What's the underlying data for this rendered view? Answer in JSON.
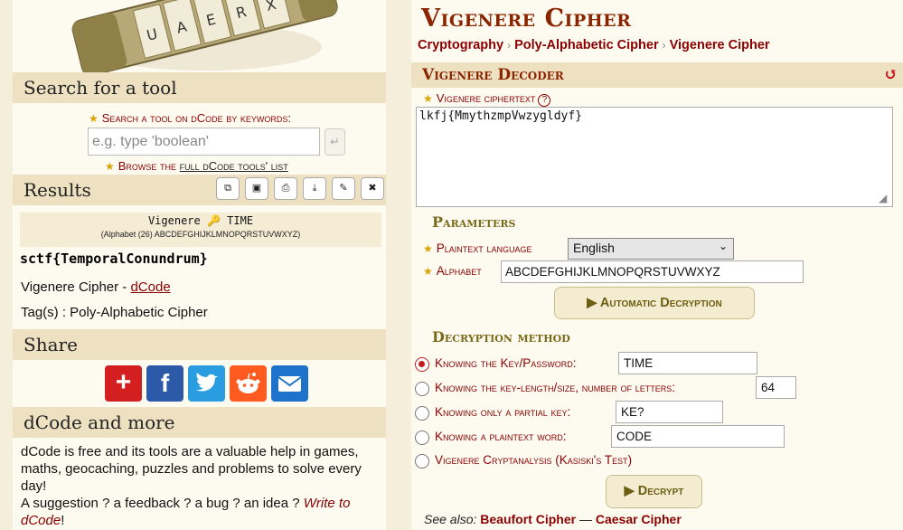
{
  "sidebar": {
    "search_heading": "Search for a tool",
    "search_label": "Search a tool on dCode by keywords:",
    "search_placeholder": "e.g. type 'boolean'",
    "search_go_icon": "↵",
    "browse_prefix": "Browse the ",
    "browse_link": "full dCode tools' list",
    "results_heading": "Results",
    "result_title": "Vigenere 🔑 TIME",
    "result_alphabet": "(Alphabet (26) ABCDEFGHIJKLMNOPQRSTUVWXYZ)",
    "result_plaintext": "sctf{TemporalConundrum}",
    "credit_prefix": "Vigenere Cipher - ",
    "credit_link": "dCode",
    "tags": "Tag(s) : Poly-Alphabetic Cipher",
    "share_heading": "Share",
    "more_heading": "dCode and more",
    "more_text_1": "dCode is free and its tools are a valuable help in games, maths, geocaching, puzzles and problems to solve every day!",
    "more_text_2": "A suggestion ? a feedback ? a bug ? an idea ? ",
    "more_text_link": "Write to dCode",
    "more_text_end": "!"
  },
  "main": {
    "title": "Vigenere Cipher",
    "breadcrumb": [
      "Cryptography",
      "Poly-Alphabetic Cipher",
      "Vigenere Cipher"
    ],
    "decoder_heading": "Vigenere Decoder",
    "ciphertext_label": "Vigenere ciphertext",
    "ciphertext_value": "lkfj{MmythzmpVwzygldyf}",
    "parameters_heading": "Parameters",
    "language_label": "Plaintext language",
    "language_value": "English",
    "alphabet_label": "Alphabet",
    "alphabet_value": "ABCDEFGHIJKLMNOPQRSTUVWXYZ",
    "auto_button": "Automatic Decryption",
    "method_heading": "Decryption method",
    "methods": [
      {
        "label": "Knowing the Key/Password:",
        "value": "TIME",
        "checked": true
      },
      {
        "label": "Knowing the key-length/size, number of letters:",
        "value": "64",
        "checked": false
      },
      {
        "label": "Knowing only a partial key:",
        "value": "KE?",
        "checked": false
      },
      {
        "label": "Knowing a plaintext word:",
        "value": "CODE",
        "checked": false
      },
      {
        "label": "Vigenere Cryptanalysis (Kasiski's Test)",
        "checked": false
      }
    ],
    "decrypt_button": "Decrypt",
    "see_also_prefix": "See also: ",
    "see_also_links": [
      "Beaufort Cipher",
      "Caesar Cipher"
    ],
    "see_also_sep": "—"
  },
  "colors": {
    "accent_red": "#8b0000",
    "title_brown": "#8b2500",
    "header_bg": "#ede1c2",
    "page_bg": "#fdfaf0"
  }
}
